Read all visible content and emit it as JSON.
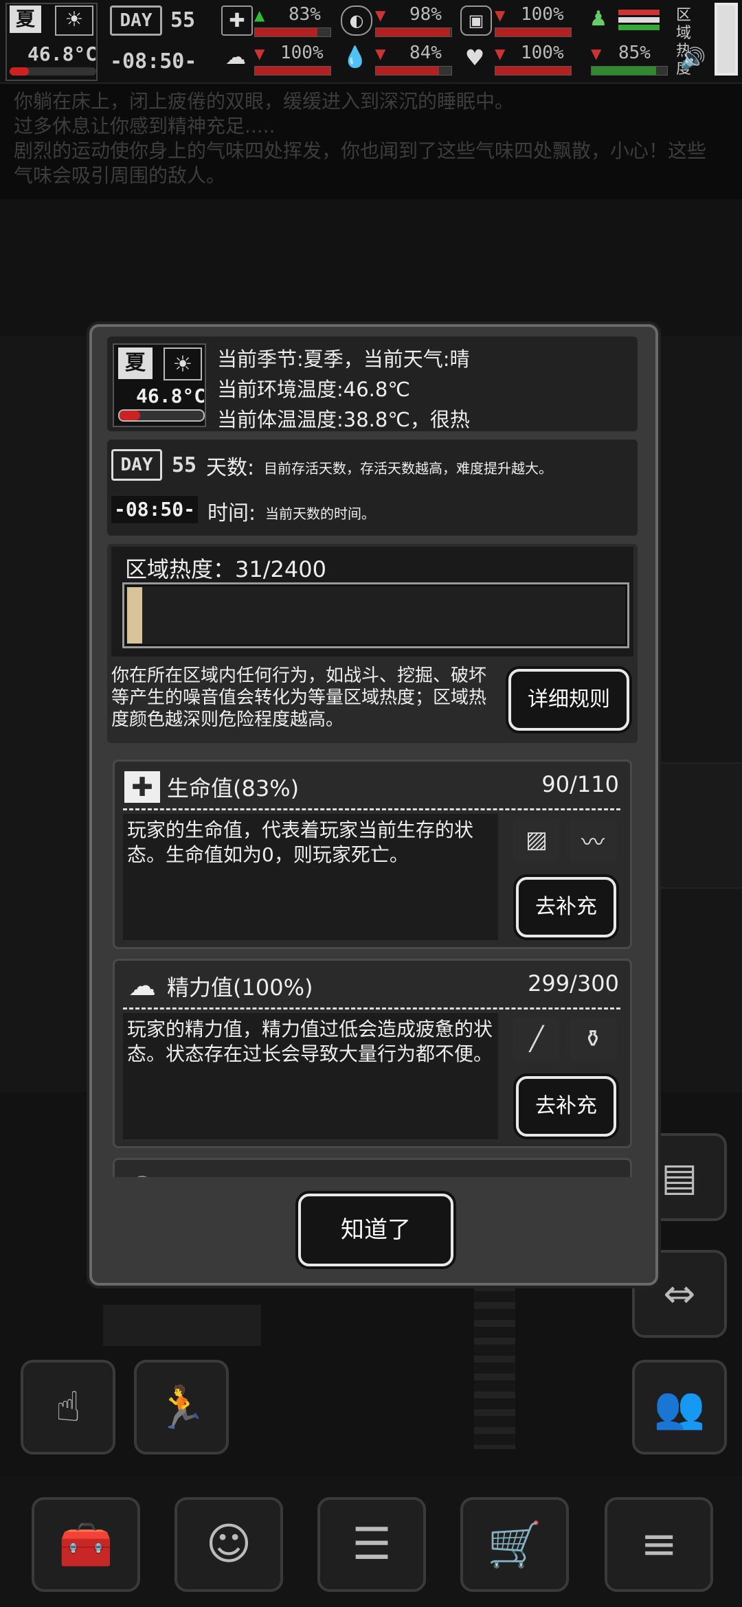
{
  "hud": {
    "season_icon_label": "夏",
    "temperature": "46.8°C",
    "day_label": "DAY",
    "day_number": "55",
    "time": "-08:50-",
    "stats": [
      {
        "name": "health",
        "value": "83%",
        "trend": "up",
        "fill": 0.83
      },
      {
        "name": "stomach",
        "value": "98%",
        "trend": "down",
        "fill": 0.98
      },
      {
        "name": "bladder",
        "value": "100%",
        "trend": "down",
        "fill": 1.0
      },
      {
        "name": "brain",
        "value": "100%",
        "trend": "down",
        "fill": 1.0
      },
      {
        "name": "water",
        "value": "84%",
        "trend": "down",
        "fill": 0.84
      },
      {
        "name": "heart",
        "value": "100%",
        "trend": "down",
        "fill": 1.0
      },
      {
        "name": "mood",
        "value": "85%",
        "trend": "down",
        "fill": 0.85
      }
    ],
    "area_heat_label": "区域热度"
  },
  "log": {
    "lines": [
      "你躺在床上，闭上疲倦的双眼，缓缓进入到深沉的睡眠中。",
      "过多休息让你感到精神充足.....",
      "剧烈的运动使你身上的气味四处挥发，你也闻到了这些气味四处飘散，小心！这些",
      "气味会吸引周围的敌人。"
    ]
  },
  "modal": {
    "weather": {
      "season_icon_label": "夏",
      "temperature": "46.8°C",
      "line1": "当前季节:夏季，当前天气:晴",
      "line2": "当前环境温度:46.8℃",
      "line3": "当前体温温度:38.8℃，很热"
    },
    "day": {
      "day_label": "DAY",
      "day_number": "55",
      "days_title": "天数:",
      "days_desc": "目前存活天数，存活天数越高，难度提升越大。",
      "time_value": "-08:50-",
      "time_title": "时间:",
      "time_desc": "当前天数的时间。"
    },
    "area_heat": {
      "title": "区域热度：31/2400",
      "current": 31,
      "max": 2400,
      "desc": "你在所在区域内任何行为，如战斗、挖掘、破坏等产生的噪音值会转化为等量区域热度；区域热度颜色越深则危险程度越高。",
      "rules_button": "详细规则"
    },
    "stats": [
      {
        "title": "生命值(83%)",
        "value": "90/110",
        "desc": "玩家的生命值，代表着玩家当前生存的状态。生命值如为0，则玩家死亡。",
        "items": [
          "bandage-icon",
          "wrap-icon"
        ],
        "button": "去补充"
      },
      {
        "title": "精力值(100%)",
        "value": "299/300",
        "desc": "玩家的精力值，精力值过低会造成疲惫的状态。状态存在过长会导致大量行为都不便。",
        "items": [
          "syringe-icon",
          "bottle-icon"
        ],
        "button": "去补充"
      }
    ],
    "confirm_button": "知道了"
  },
  "colors": {
    "hud_bar_red": "#b32020",
    "hud_bar_green": "#2f8a2f",
    "heat_fill": "#d9c49a",
    "modal_bg": "#3a3a3a"
  }
}
